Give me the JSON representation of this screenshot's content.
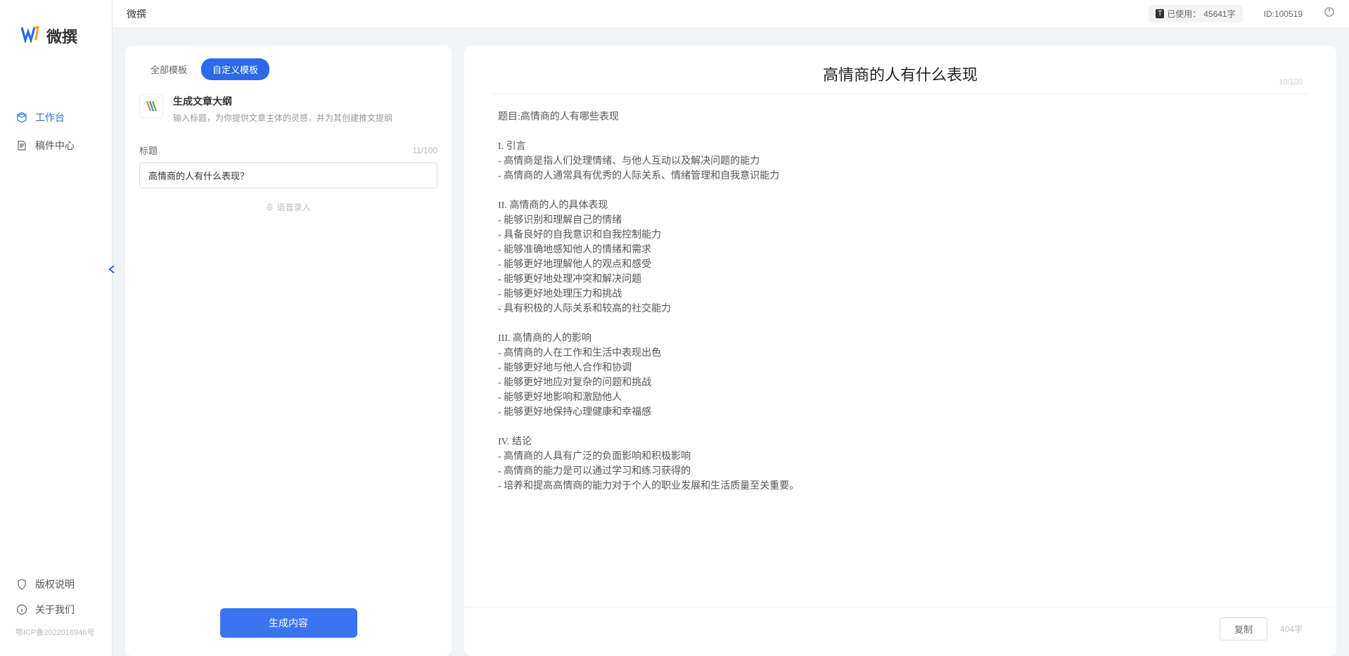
{
  "logo": {
    "text": "微撰"
  },
  "topbar": {
    "title": "微撰",
    "usage_prefix": "已使用：",
    "usage_value": "45641字",
    "user_id": "ID:100519"
  },
  "sidebar": {
    "items": [
      {
        "label": "工作台"
      },
      {
        "label": "稿件中心"
      }
    ],
    "bottom": [
      {
        "label": "版权说明"
      },
      {
        "label": "关于我们"
      }
    ],
    "icp": "鄂ICP备2022016946号"
  },
  "tabs": {
    "all": "全部模板",
    "custom": "自定义模板"
  },
  "template": {
    "title": "生成文章大纲",
    "desc": "输入标题，为你提供文章主体的灵感，并为其创建推文提纲"
  },
  "form": {
    "label": "标题",
    "char_count": "11/100",
    "value": "高情商的人有什么表现？",
    "voice_label": "语音录入"
  },
  "gen_label": "生成内容",
  "output": {
    "title": "高情商的人有什么表现",
    "header_count": "10/100",
    "body": "题目:高情商的人有哪些表现\n\nI. 引言\n- 高情商是指人们处理情绪、与他人互动以及解决问题的能力\n- 高情商的人通常具有优秀的人际关系、情绪管理和自我意识能力\n\nII. 高情商的人的具体表现\n- 能够识别和理解自己的情绪\n- 具备良好的自我意识和自我控制能力\n- 能够准确地感知他人的情绪和需求\n- 能够更好地理解他人的观点和感受\n- 能够更好地处理冲突和解决问题\n- 能够更好地处理压力和挑战\n- 具有积极的人际关系和较高的社交能力\n\nIII. 高情商的人的影响\n- 高情商的人在工作和生活中表现出色\n- 能够更好地与他人合作和协调\n- 能够更好地应对复杂的问题和挑战\n- 能够更好地影响和激励他人\n- 能够更好地保持心理健康和幸福感\n\nIV. 结论\n- 高情商的人具有广泛的负面影响和积极影响\n- 高情商的能力是可以通过学习和练习获得的\n- 培养和提高高情商的能力对于个人的职业发展和生活质量至关重要。",
    "copy_label": "复制",
    "word_count": "404字"
  }
}
